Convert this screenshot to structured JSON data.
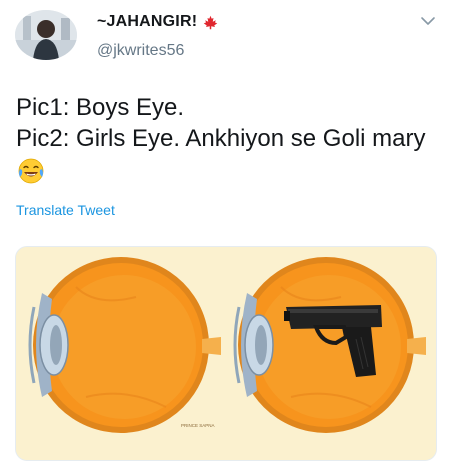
{
  "author": {
    "display_name": "~JAHANGIR!",
    "handle": "@jkwrites56",
    "flag_icon": "maple-leaf-icon"
  },
  "tweet": {
    "lines": [
      "Pic1: Boys Eye.",
      "Pic2: Girls Eye. Ankhiyon se Goli mary"
    ],
    "emoji": "face-with-tears-of-joy-emoji",
    "translate_label": "Translate Tweet"
  },
  "media": {
    "left_panel": "eye-diagram",
    "right_panel": "eye-diagram-with-pistol",
    "credit": "PRINCE SAPNA"
  },
  "colors": {
    "link": "#1b95e0",
    "secondary_text": "#657786",
    "eye_orange": "#f7941d",
    "media_background": "#fbf1cf"
  }
}
